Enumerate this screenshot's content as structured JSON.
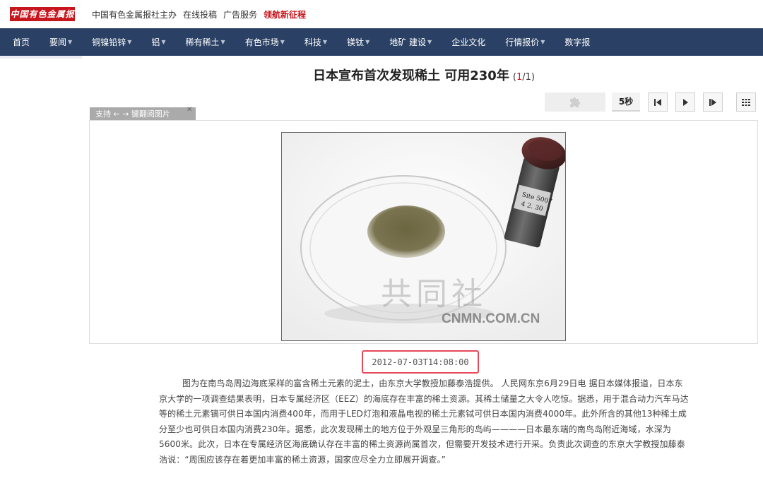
{
  "topbar": {
    "logo_text": "中国有色金属报",
    "links": [
      "中国有色金属报社主办",
      "在线投稿",
      "广告服务"
    ],
    "highlight": "领航新征程"
  },
  "nav": {
    "items": [
      {
        "label": "首页",
        "dropdown": false
      },
      {
        "label": "要闻",
        "dropdown": true
      },
      {
        "label": "铜镍铅锌",
        "dropdown": true
      },
      {
        "label": "铝",
        "dropdown": true
      },
      {
        "label": "稀有稀土",
        "dropdown": true
      },
      {
        "label": "有色市场",
        "dropdown": true
      },
      {
        "label": "科技",
        "dropdown": true
      },
      {
        "label": "镁钛",
        "dropdown": true
      },
      {
        "label": "地矿 建设",
        "dropdown": true
      },
      {
        "label": "企业文化",
        "dropdown": false
      },
      {
        "label": "行情报价",
        "dropdown": true
      },
      {
        "label": "数字报",
        "dropdown": false
      }
    ]
  },
  "article": {
    "title": "日本宣布首次发现稀土 可用230年",
    "page_open": "(",
    "page_current": "1",
    "page_sep": "/1)",
    "hint": "支持 ← → 键翻阅图片",
    "date": "2012-07-03T14:08:00",
    "body": "图为在南鸟岛周边海底采样的富含稀土元素的泥土，由东京大学教授加藤泰浩提供。 人民网东京6月29日电 据日本媒体报道，日本东京大学的一项调查结果表明，日本专属经济区（EEZ）的海底存在丰富的稀土资源。其稀土储量之大令人吃惊。据悉，用于混合动力汽车马达等的稀土元素镝可供日本国内消费400年，而用于LED灯泡和液晶电视的稀土元素铽可供日本国内消费4000年。此外所含的其他13种稀土成分至少也可供日本国内消费230年。据悉，此次发现稀土的地方位于外观呈三角形的岛屿————日本最东端的南鸟岛附近海域，水深为5600米。此次，日本在专属经济区海底确认存在丰富的稀土资源尚属首次，但需要开发技术进行开采。负责此次调查的东京大学教授加藤泰浩说：“周围应该存在着更加丰富的稀土资源，国家应尽全力立即展开调查。”"
  },
  "toolbar": {
    "speed_label": "5秒",
    "icons": [
      "puzzle-icon",
      "prev-icon",
      "play-icon",
      "next-icon",
      "grid-icon"
    ]
  },
  "photo": {
    "watermark_cn": "共同社",
    "watermark_en": "CNMN.COM.CN",
    "vial_label": "Site 5007\n4 2. 30"
  },
  "colors": {
    "nav_bg": "#2a4064",
    "accent_red": "#c8161d",
    "date_highlight": "#e7495a"
  }
}
